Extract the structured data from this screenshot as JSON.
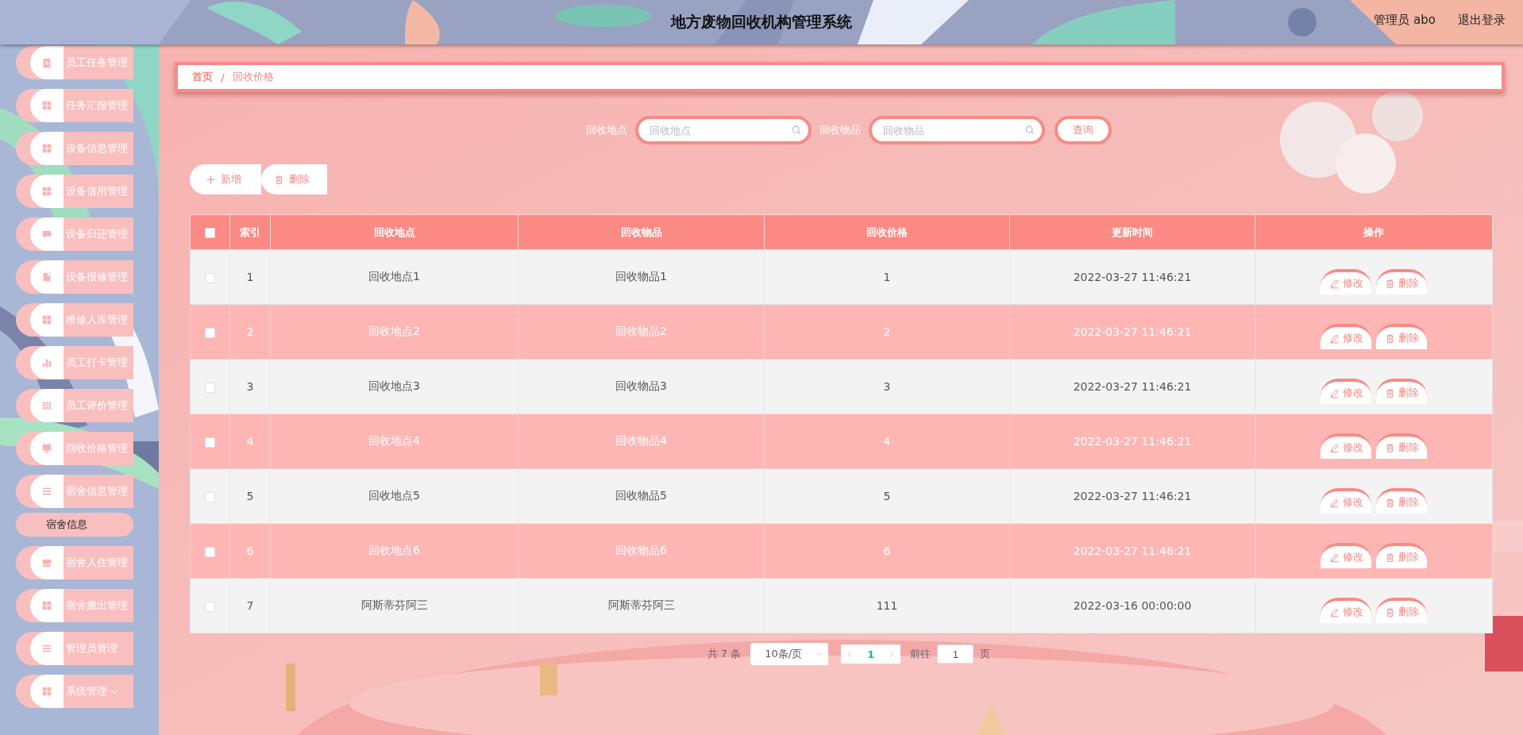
{
  "header": {
    "title": "地方废物回收机构管理系统",
    "user": "管理员 abo",
    "logout": "退出登录"
  },
  "sidebar": {
    "items": [
      {
        "label": "员工任务管理"
      },
      {
        "label": "任务汇报管理"
      },
      {
        "label": "设备信息管理"
      },
      {
        "label": "设备借用管理"
      },
      {
        "label": "设备归还管理"
      },
      {
        "label": "设备报修管理"
      },
      {
        "label": "维修入库管理"
      },
      {
        "label": "员工打卡管理"
      },
      {
        "label": "员工评价管理"
      },
      {
        "label": "回收价格管理"
      },
      {
        "label": "宿舍信息管理",
        "expanded": true,
        "children": [
          {
            "label": "宿舍信息",
            "selected": true
          }
        ]
      },
      {
        "label": "宿舍入住管理"
      },
      {
        "label": "宿舍搬出管理"
      },
      {
        "label": "管理员管理"
      },
      {
        "label": "系统管理",
        "expanded": false
      }
    ]
  },
  "breadcrumb": {
    "separator": "/",
    "items": [
      {
        "label": "首页"
      },
      {
        "label": "回收价格"
      }
    ]
  },
  "search": {
    "fields": [
      {
        "label": "回收地点",
        "placeholder": "回收地点"
      },
      {
        "label": "回收物品",
        "placeholder": "回收物品"
      }
    ],
    "button": "查询"
  },
  "toolbar": {
    "add": "新增",
    "delete": "删除"
  },
  "table": {
    "select_all_checked": false,
    "columns": [
      "索引",
      "回收地点",
      "回收物品",
      "回收价格",
      "更新时间",
      "操作"
    ],
    "rows": [
      {
        "checked": false,
        "cells": [
          "1",
          "回收地点1",
          "回收物品1",
          "1",
          "2022-03-27 11:46:21"
        ],
        "actions": [
          "修改",
          "删除"
        ]
      },
      {
        "checked": false,
        "cells": [
          "2",
          "回收地点2",
          "回收物品2",
          "2",
          "2022-03-27 11:46:21"
        ],
        "actions": [
          "修改",
          "删除"
        ]
      },
      {
        "checked": false,
        "cells": [
          "3",
          "回收地点3",
          "回收物品3",
          "3",
          "2022-03-27 11:46:21"
        ],
        "actions": [
          "修改",
          "删除"
        ]
      },
      {
        "checked": false,
        "cells": [
          "4",
          "回收地点4",
          "回收物品4",
          "4",
          "2022-03-27 11:46:21"
        ],
        "actions": [
          "修改",
          "删除"
        ]
      },
      {
        "checked": false,
        "cells": [
          "5",
          "回收地点5",
          "回收物品5",
          "5",
          "2022-03-27 11:46:21"
        ],
        "actions": [
          "修改",
          "删除"
        ]
      },
      {
        "checked": false,
        "cells": [
          "6",
          "回收地点6",
          "回收物品6",
          "6",
          "2022-03-27 11:46:21"
        ],
        "actions": [
          "修改",
          "删除"
        ]
      },
      {
        "checked": false,
        "cells": [
          "7",
          "阿斯蒂芬阿三",
          "阿斯蒂芬阿三",
          "111",
          "2022-03-16 00:00:00"
        ],
        "actions": [
          "修改",
          "删除"
        ]
      }
    ]
  },
  "pagination": {
    "total": "共 7 条",
    "page_size": "10条/页",
    "pages": [
      {
        "label": "1",
        "selected": true
      }
    ],
    "goto_label": "前往",
    "goto_value": "1",
    "page_suffix": "页"
  }
}
